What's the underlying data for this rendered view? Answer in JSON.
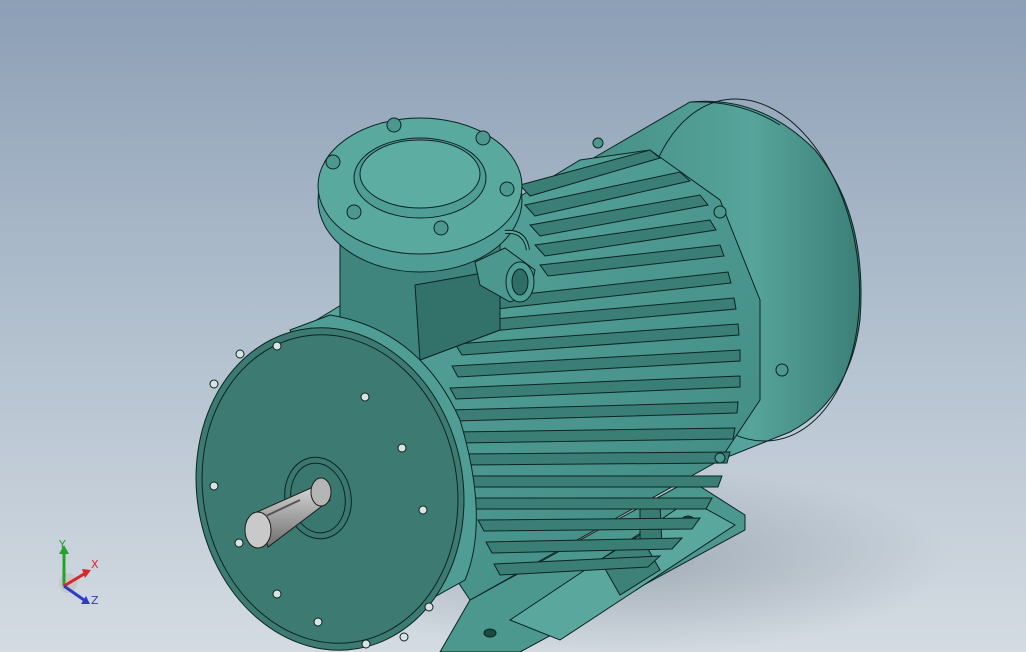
{
  "viewport": {
    "background_top": "#8d9fb6",
    "background_bottom": "#d4dbe2"
  },
  "model": {
    "body_color": "#4f9d94",
    "body_dark": "#2f6e67",
    "flange_face": "#3c7a72",
    "edge_color": "#0c2422"
  },
  "triad": {
    "y_label": "Y",
    "x_label": "X",
    "z_label": "Z",
    "y_color": "#27a02e",
    "x_color": "#d8262a",
    "z_color": "#2b3fbf"
  }
}
